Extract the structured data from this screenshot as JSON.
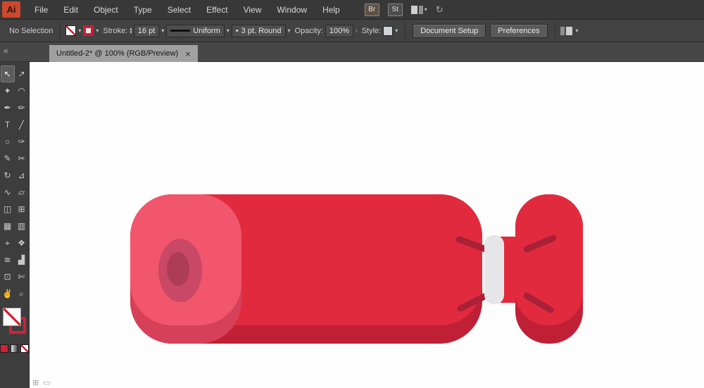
{
  "menubar": {
    "logo": "Ai",
    "items": [
      "File",
      "Edit",
      "Object",
      "Type",
      "Select",
      "Effect",
      "View",
      "Window",
      "Help"
    ],
    "bridge_label": "Br",
    "stock_label": "St"
  },
  "controlbar": {
    "selection_status": "No Selection",
    "stroke_label": "Stroke:",
    "stroke_weight": "16 pt",
    "width_profile": "Uniform",
    "brush_bullet": "•",
    "brush_name": "3 pt. Round",
    "opacity_label": "Opacity:",
    "opacity_value": "100%",
    "style_label": "Style:",
    "document_setup_label": "Document Setup",
    "preferences_label": "Preferences"
  },
  "tabbar": {
    "tab_title": "Untitled-2* @ 100% (RGB/Preview)",
    "close_glyph": "×",
    "collapse_glyph": "«"
  },
  "icons": {
    "chevron_down": "▾",
    "chevron_right": "›",
    "stepper_up": "▴",
    "stepper_down": "▾",
    "sync": "↻",
    "status_left": "⊞",
    "status_right": "▭"
  },
  "toolbar": {
    "tools": [
      {
        "name": "selection",
        "glyph": "↖"
      },
      {
        "name": "direct-selection",
        "glyph": "↗"
      },
      {
        "name": "magic-wand",
        "glyph": "✦"
      },
      {
        "name": "lasso",
        "glyph": "◠"
      },
      {
        "name": "pen",
        "glyph": "✒"
      },
      {
        "name": "shaper",
        "glyph": "✏"
      },
      {
        "name": "type",
        "glyph": "T"
      },
      {
        "name": "line-segment",
        "glyph": "╱"
      },
      {
        "name": "ellipse",
        "glyph": "○"
      },
      {
        "name": "paintbrush",
        "glyph": "✑"
      },
      {
        "name": "pencil",
        "glyph": "✎"
      },
      {
        "name": "scissors",
        "glyph": "✂"
      },
      {
        "name": "rotate",
        "glyph": "↻"
      },
      {
        "name": "scale",
        "glyph": "⊿"
      },
      {
        "name": "width",
        "glyph": "∿"
      },
      {
        "name": "free-transform",
        "glyph": "▱"
      },
      {
        "name": "shape-builder",
        "glyph": "◫"
      },
      {
        "name": "perspective-grid",
        "glyph": "⊞"
      },
      {
        "name": "mesh",
        "glyph": "▦"
      },
      {
        "name": "gradient",
        "glyph": "▥"
      },
      {
        "name": "eyedropper",
        "glyph": "⌖"
      },
      {
        "name": "blend",
        "glyph": "❖"
      },
      {
        "name": "symbol-sprayer",
        "glyph": "≋"
      },
      {
        "name": "column-graph",
        "glyph": "▟"
      },
      {
        "name": "artboard",
        "glyph": "⊡"
      },
      {
        "name": "slice",
        "glyph": "✄"
      },
      {
        "name": "hand",
        "glyph": "✌"
      },
      {
        "name": "zoom",
        "glyph": "⌕"
      }
    ]
  },
  "artwork": {
    "name": "sausage-illustration",
    "colors": {
      "body_red": "#e22a3e",
      "shadow_red": "#c02036",
      "cap_pink": "#f2566c",
      "cap_shadow": "#d64059",
      "oval_mid": "#c84865",
      "oval_dark": "#ad3c57",
      "band_gray": "#e6e6e8",
      "string_dark": "#a92037"
    }
  }
}
